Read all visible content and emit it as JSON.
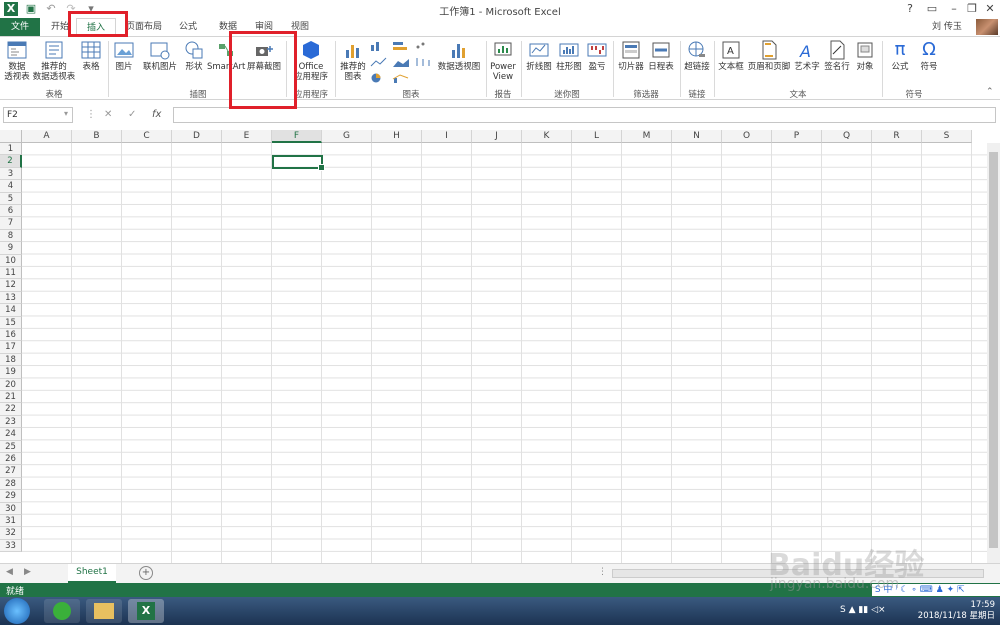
{
  "window": {
    "title": "工作簿1 - Microsoft Excel",
    "controls": [
      "?",
      "▭",
      "–",
      "❐",
      "✕"
    ]
  },
  "quick_access": {
    "app_icon": "excel-icon",
    "save": "save-icon",
    "undo": "undo-icon",
    "redo": "redo-icon"
  },
  "tabs": [
    {
      "label": "文件"
    },
    {
      "label": "开始"
    },
    {
      "label": "插入"
    },
    {
      "label": "页面布局"
    },
    {
      "label": "公式"
    },
    {
      "label": "数据"
    },
    {
      "label": "审阅"
    },
    {
      "label": "视图"
    }
  ],
  "user": {
    "name": "刘 传玉"
  },
  "ribbon": {
    "buttons": [
      {
        "label": "数据\n透视表"
      },
      {
        "label": "推荐的\n数据透视表"
      },
      {
        "label": "表格"
      },
      {
        "label": "图片"
      },
      {
        "label": "联机图片"
      },
      {
        "label": "形状"
      },
      {
        "label": "SmartArt"
      },
      {
        "label": "屏幕截图"
      },
      {
        "label": "Office\n应用程序"
      },
      {
        "label": "推荐的\n图表"
      },
      {
        "label": "数据透视图"
      },
      {
        "label": "Power\nView"
      },
      {
        "label": "折线图"
      },
      {
        "label": "柱形图"
      },
      {
        "label": "盈亏"
      },
      {
        "label": "切片器"
      },
      {
        "label": "日程表"
      },
      {
        "label": "超链接"
      },
      {
        "label": "文本框"
      },
      {
        "label": "页眉和页脚"
      },
      {
        "label": "艺术字"
      },
      {
        "label": "签名行"
      },
      {
        "label": "对象"
      },
      {
        "label": "公式"
      },
      {
        "label": "符号"
      }
    ],
    "groups": [
      {
        "label": "表格"
      },
      {
        "label": "插图"
      },
      {
        "label": "应用程序"
      },
      {
        "label": "图表"
      },
      {
        "label": "报告"
      },
      {
        "label": "迷你图"
      },
      {
        "label": "筛选器"
      },
      {
        "label": "链接"
      },
      {
        "label": "文本"
      },
      {
        "label": "符号"
      }
    ]
  },
  "formula_bar": {
    "name_box": "F2",
    "fx": "fx",
    "cancel": "✕",
    "enter": "✓",
    "formula": ""
  },
  "grid": {
    "columns": [
      "A",
      "B",
      "C",
      "D",
      "E",
      "F",
      "G",
      "H",
      "I",
      "J",
      "K",
      "L",
      "M",
      "N",
      "O",
      "P",
      "Q",
      "R",
      "S"
    ],
    "rows": [
      "1",
      "2",
      "3",
      "4",
      "5",
      "6",
      "7",
      "8",
      "9",
      "10",
      "11",
      "12",
      "13",
      "14",
      "15",
      "16",
      "17",
      "18",
      "19",
      "20",
      "21",
      "22",
      "23",
      "24",
      "25",
      "26",
      "27",
      "28",
      "29",
      "30",
      "31",
      "32",
      "33"
    ],
    "selected_column": "F",
    "selected_row": "2"
  },
  "sheets": {
    "tabs": [
      {
        "label": "Sheet1"
      }
    ],
    "add": "+"
  },
  "statusbar": {
    "ready": "就绪"
  },
  "taskbar": {
    "time": "17:59",
    "date": "2018/11/18 星期日"
  },
  "watermark": {
    "text": "Baidu经验",
    "sub": "jingyan.baidu.com"
  },
  "colors": {
    "accent": "#217346",
    "annotation": "#e0202a"
  }
}
